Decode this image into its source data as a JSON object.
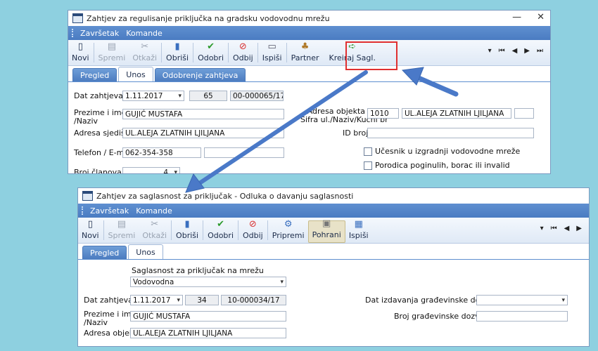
{
  "win1": {
    "title": "Zahtjev za regulisanje priključka na gradsku vodovodnu mrežu",
    "menu": [
      "Završetak",
      "Komande"
    ],
    "toolbar": {
      "novi": "Novi",
      "spremi": "Spremi",
      "otkazi": "Otkaži",
      "obrisi": "Obriši",
      "odobri": "Odobri",
      "odbij": "Odbij",
      "ispisi": "Ispiši",
      "partner": "Partner",
      "kreiraj": "Kreiraj Sagl."
    },
    "tabs": [
      "Pregled",
      "Unos",
      "Odobrenje zahtjeva"
    ],
    "fields": {
      "dat_label": "Dat zahtjeva",
      "dat_value": "1.11.2017",
      "num": "65",
      "code": "00-000065/17",
      "prezime_label": "Prezime i ime\n/Naziv",
      "prezime_value": "GUJIĆ MUSTAFA",
      "adresa_label": "Adresa sjedišta",
      "adresa_value": "UL.ALEJA ZLATNIH LJILJANA",
      "telefon_label": "Telefon / E-mail",
      "telefon_value": "062-354-358",
      "broj_label": "Broj članova",
      "broj_value": "4",
      "adresa_obj_label": "Adresa objekta\nŠifra ul./Naziv/Kućni br",
      "sifra_value": "1010",
      "ulica_value": "UL.ALEJA ZLATNIH LJILJANA",
      "id_label": "ID broj",
      "ucesnik_label": "Učesnik u izgradnji vodovodne mreže",
      "porodica_label": "Porodica poginulih, borac ili invalid"
    }
  },
  "win2": {
    "title": "Zahtjev za saglasnost za priključak  - Odluka o davanju saglasnosti",
    "menu": [
      "Završetak",
      "Komande"
    ],
    "toolbar": {
      "novi": "Novi",
      "spremi": "Spremi",
      "otkazi": "Otkaži",
      "obrisi": "Obriši",
      "odobri": "Odobri",
      "odbij": "Odbij",
      "pripremi": "Pripremi",
      "pohrani": "Pohrani",
      "ispisi": "Ispiši"
    },
    "tabs": [
      "Pregled",
      "Unos"
    ],
    "fields": {
      "sagl_label": "Saglasnost za priključak na mrežu",
      "sagl_value": "Vodovodna",
      "dat_label": "Dat zahtjeva",
      "dat_value": "1.11.2017",
      "num": "34",
      "code": "10-000034/17",
      "prezime_label": "Prezime i ime\n/Naziv",
      "prezime_value": "GUJIĆ MUSTAFA",
      "adresa_label": "Adresa objekta",
      "adresa_value": "UL.ALEJA ZLATNIH LJILJANA",
      "dat_izd_label": "Dat izdavanja građevinske dozvole",
      "broj_dozv_label": "Broj građevinske dozvole"
    }
  },
  "colors": {
    "arrow": "#4a79c8",
    "highlight": "#e03030",
    "menubar": "#4a7cc2",
    "background": "#8ed0e0"
  }
}
